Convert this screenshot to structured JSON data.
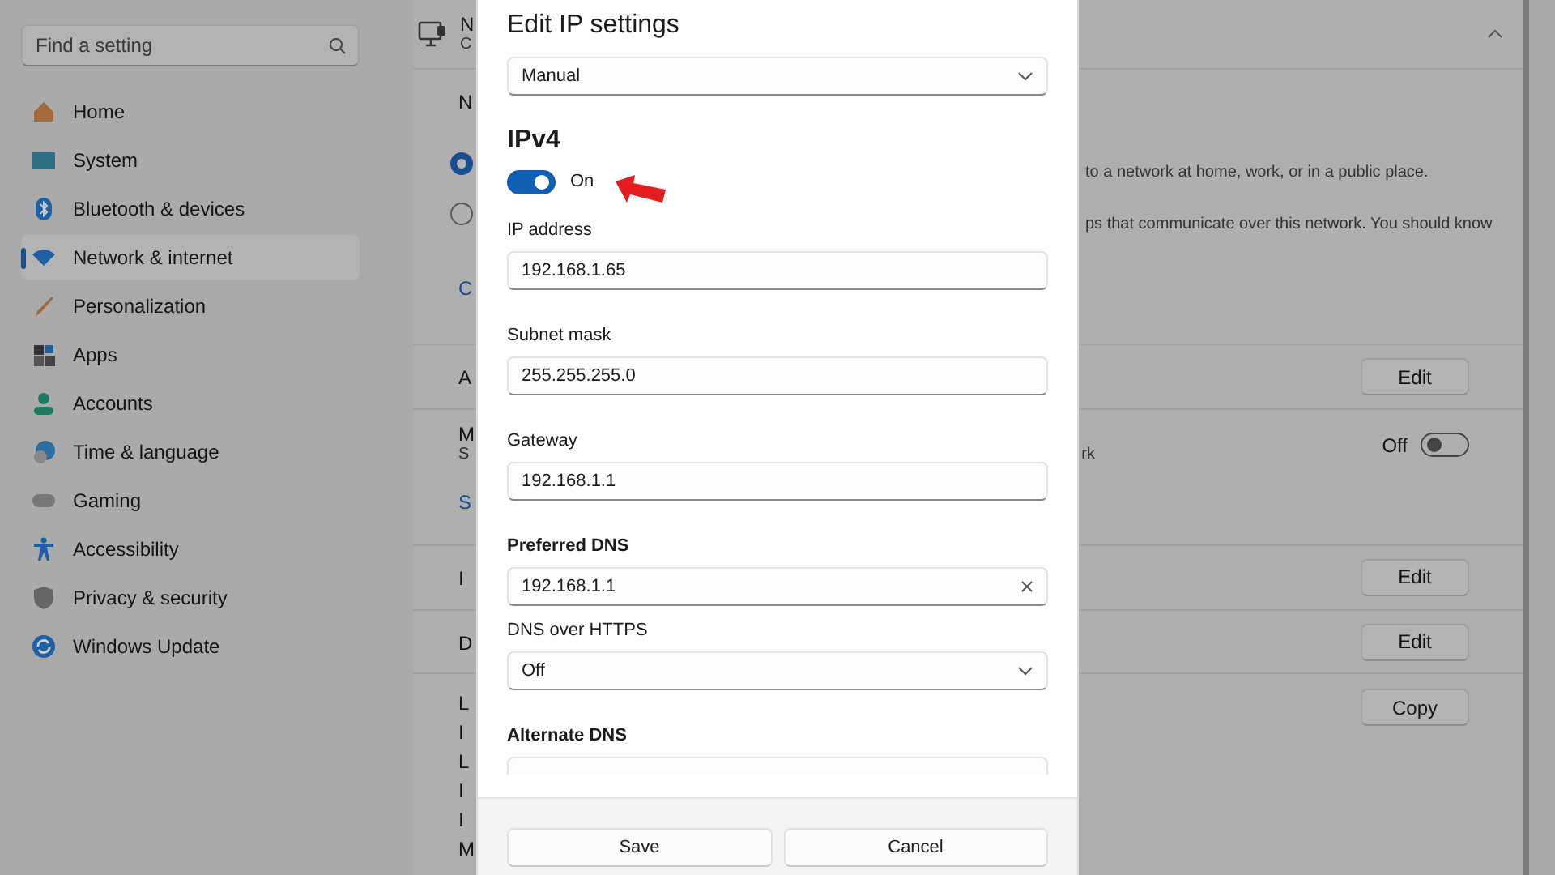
{
  "sidebar": {
    "search": {
      "placeholder": "Find a setting"
    },
    "items": [
      {
        "label": "Home",
        "selected": false
      },
      {
        "label": "System",
        "selected": false
      },
      {
        "label": "Bluetooth & devices",
        "selected": false
      },
      {
        "label": "Network & internet",
        "selected": true
      },
      {
        "label": "Personalization",
        "selected": false
      },
      {
        "label": "Apps",
        "selected": false
      },
      {
        "label": "Accounts",
        "selected": false
      },
      {
        "label": "Time & language",
        "selected": false
      },
      {
        "label": "Gaming",
        "selected": false
      },
      {
        "label": "Accessibility",
        "selected": false
      },
      {
        "label": "Privacy & security",
        "selected": false
      },
      {
        "label": "Windows Update",
        "selected": false
      }
    ]
  },
  "panel": {
    "header": {
      "title": "N",
      "subtitle": "C",
      "expanded": true
    },
    "profile": {
      "title": "N",
      "options": [
        {
          "selected": true,
          "description": "to a network at home, work, or in a public place."
        },
        {
          "selected": false,
          "description": "ps that communicate over this network. You should know"
        }
      ],
      "link": "C"
    },
    "rows": [
      {
        "kind": "button",
        "label": "A",
        "button": "Edit"
      },
      {
        "kind": "toggle",
        "label": "M",
        "description": "S",
        "description_tail": "rk",
        "state_label": "Off",
        "on": false,
        "link": "S"
      },
      {
        "kind": "button",
        "label": "I",
        "button": "Edit"
      },
      {
        "kind": "button",
        "label": "D",
        "button": "Edit"
      },
      {
        "kind": "list",
        "lines": [
          "L",
          "I",
          "L",
          "I",
          "I",
          "M"
        ],
        "button": "Copy"
      }
    ]
  },
  "dialog": {
    "title": "Edit IP settings",
    "mode": "Manual",
    "section": "IPv4",
    "ipv4": {
      "on": true,
      "state_label": "On"
    },
    "fields": [
      {
        "kind": "text",
        "label": "IP address",
        "value": "192.168.1.65"
      },
      {
        "kind": "text",
        "label": "Subnet mask",
        "value": "255.255.255.0"
      },
      {
        "kind": "text",
        "label": "Gateway",
        "value": "192.168.1.1"
      },
      {
        "kind": "text",
        "label": "Preferred DNS",
        "value": "192.168.1.1",
        "bold": true,
        "clearable": true
      },
      {
        "kind": "select",
        "label": "DNS over HTTPS",
        "value": "Off"
      },
      {
        "kind": "text",
        "label": "Alternate DNS",
        "bold": true
      }
    ],
    "buttons": [
      {
        "label": "Save"
      },
      {
        "label": "Cancel"
      }
    ]
  }
}
